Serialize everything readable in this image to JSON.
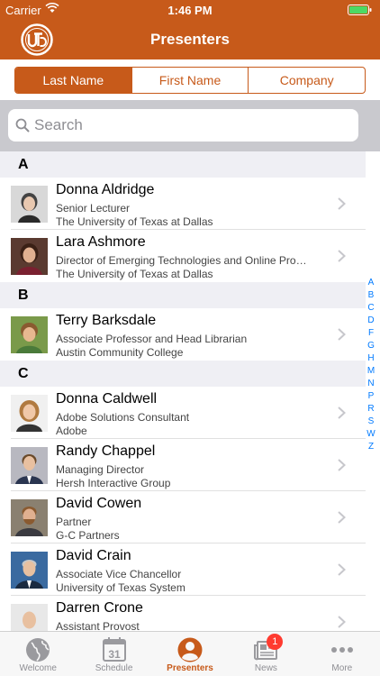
{
  "status": {
    "carrier": "Carrier",
    "time": "1:46 PM"
  },
  "header": {
    "title": "Presenters"
  },
  "segments": [
    {
      "label": "Last Name",
      "active": true
    },
    {
      "label": "First Name",
      "active": false
    },
    {
      "label": "Company",
      "active": false
    }
  ],
  "search": {
    "placeholder": "Search"
  },
  "sections": [
    {
      "letter": "A",
      "people": [
        {
          "name": "Donna Aldridge",
          "title": "Senior Lecturer",
          "org": "The University of Texas at Dallas"
        },
        {
          "name": "Lara Ashmore",
          "title": "Director of Emerging Technologies and Online Pro…",
          "org": "The University of Texas at Dallas"
        }
      ]
    },
    {
      "letter": "B",
      "people": [
        {
          "name": "Terry Barksdale",
          "title": "Associate Professor and Head Librarian",
          "org": "Austin Community College"
        }
      ]
    },
    {
      "letter": "C",
      "people": [
        {
          "name": "Donna Caldwell",
          "title": "Adobe Solutions Consultant",
          "org": "Adobe"
        },
        {
          "name": "Randy Chappel",
          "title": "Managing Director",
          "org": "Hersh Interactive Group"
        },
        {
          "name": "David Cowen",
          "title": "Partner",
          "org": "G-C Partners"
        },
        {
          "name": "David Crain",
          "title": "Associate Vice Chancellor",
          "org": "University of Texas System"
        },
        {
          "name": "Darren Crone",
          "title": "Assistant Provost",
          "org": ""
        }
      ]
    }
  ],
  "index_letters": [
    "A",
    "B",
    "C",
    "D",
    "F",
    "G",
    "H",
    "M",
    "N",
    "P",
    "R",
    "S",
    "W",
    "Z"
  ],
  "tabs": [
    {
      "label": "Welcome",
      "icon": "globe-icon"
    },
    {
      "label": "Schedule",
      "icon": "calendar-icon",
      "day": "31"
    },
    {
      "label": "Presenters",
      "icon": "person-icon",
      "active": true
    },
    {
      "label": "News",
      "icon": "newspaper-icon",
      "badge": "1"
    },
    {
      "label": "More",
      "icon": "more-icon"
    }
  ],
  "colors": {
    "accent": "#c75a1a",
    "link": "#007aff",
    "badge": "#ff3b30"
  }
}
